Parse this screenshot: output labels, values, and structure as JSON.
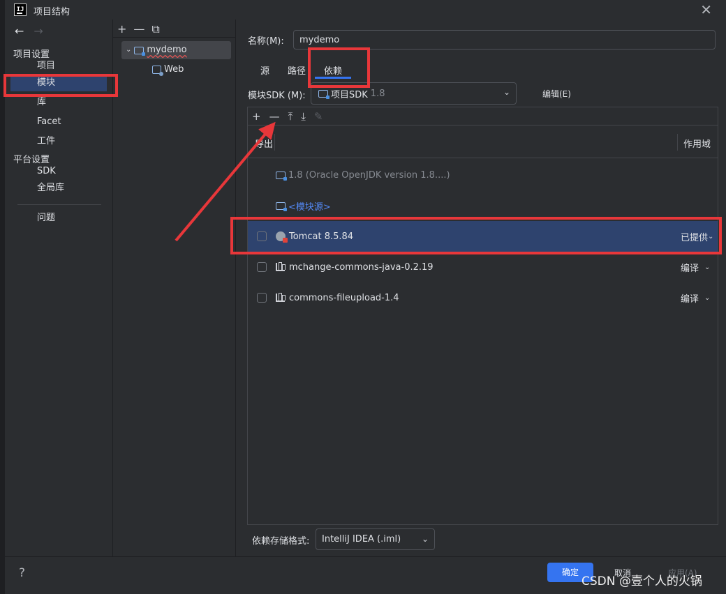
{
  "window": {
    "title": "项目结构"
  },
  "nav": {
    "sections": [
      {
        "label": "项目设置"
      },
      {
        "label": "平台设置"
      }
    ],
    "items": [
      {
        "label": "项目"
      },
      {
        "label": "模块"
      },
      {
        "label": "库"
      },
      {
        "label": "Facet"
      },
      {
        "label": "工件"
      },
      {
        "label": "SDK"
      },
      {
        "label": "全局库"
      },
      {
        "label": "问题"
      }
    ],
    "selected": "模块"
  },
  "tree": {
    "toolbar": [
      "+",
      "—",
      "⧉"
    ],
    "nodes": [
      {
        "label": "mydemo",
        "expanded": true
      },
      {
        "label": "Web"
      }
    ]
  },
  "module": {
    "name_label": "名称(M):",
    "name_value": "mydemo",
    "tabs": [
      "源",
      "路径",
      "依赖"
    ],
    "active_tab": "依赖",
    "sdk_label": "模块SDK (M):",
    "sdk_value": "项目SDK",
    "sdk_version": "1.8",
    "edit_label": "编辑(E)"
  },
  "dependencies": {
    "toolbar": [
      "+",
      "—",
      "⤒",
      "⤓",
      "✎"
    ],
    "col_export": "导出",
    "col_scope": "作用域",
    "rows": [
      {
        "name": "1.8 (Oracle OpenJDK version 1.8....)",
        "scope": "",
        "checkbox": false,
        "style": "dim"
      },
      {
        "name": "<模块源>",
        "scope": "",
        "checkbox": false,
        "style": "link"
      },
      {
        "name": "Tomcat 8.5.84",
        "scope": "已提供",
        "checkbox": true,
        "selected": true
      },
      {
        "name": "mchange-commons-java-0.2.19",
        "scope": "编译",
        "checkbox": true
      },
      {
        "name": "commons-fileupload-1.4",
        "scope": "编译",
        "checkbox": true
      }
    ]
  },
  "storage": {
    "label": "依赖存储格式:",
    "value": "IntelliJ IDEA (.iml)"
  },
  "footer": {
    "help": "?",
    "ok": "确定",
    "cancel": "取消",
    "apply": "应用(A)",
    "watermark": "CSDN @壹个人的火锅"
  },
  "colors": {
    "accent": "#3574f0",
    "selection": "#2e436e",
    "annotation": "#e8373a",
    "background": "#2b2d30"
  }
}
